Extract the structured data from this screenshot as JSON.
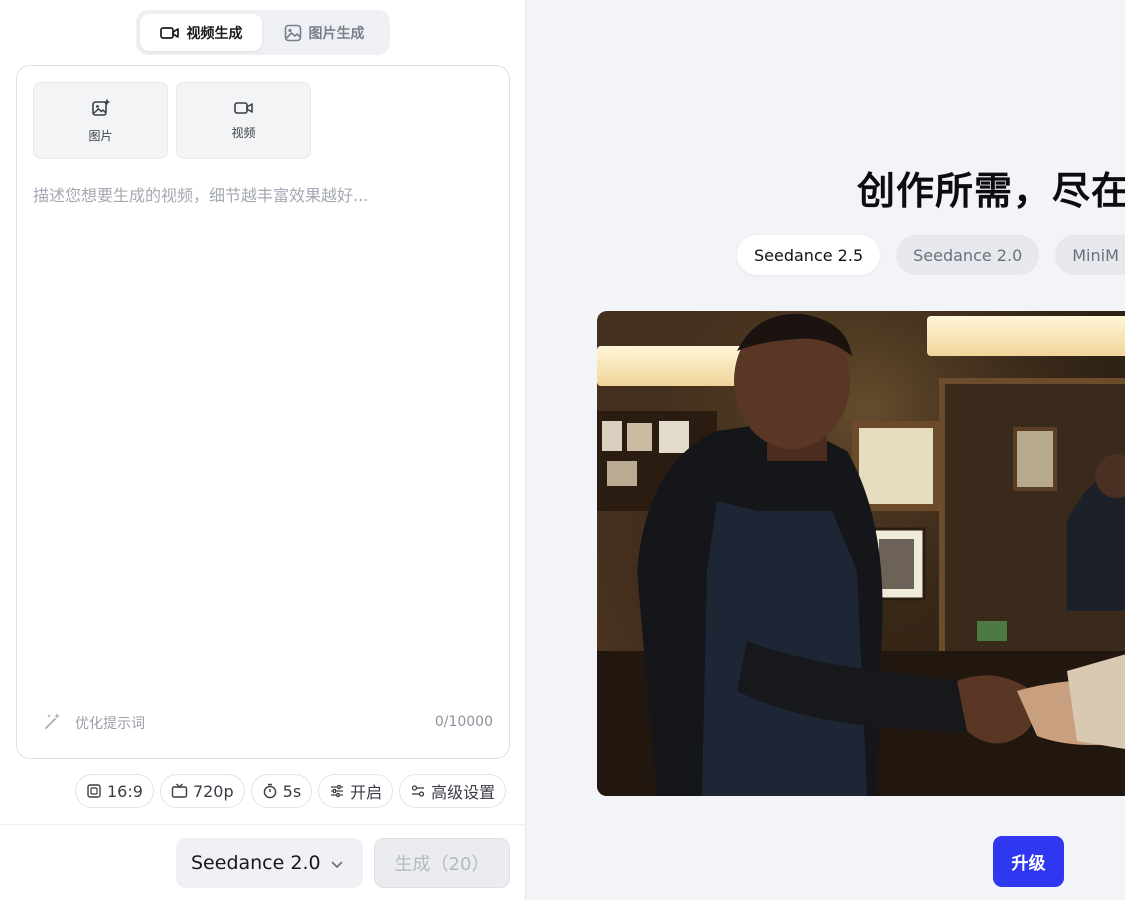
{
  "mode_tabs": {
    "video_label": "视频生成",
    "image_label": "图片生成"
  },
  "editor": {
    "upload_image_label": "图片",
    "upload_video_label": "视频",
    "prompt_placeholder": "描述您想要生成的视频，细节越丰富效果越好...",
    "optimize_label": "优化提示词",
    "char_counter": "0/10000"
  },
  "options": {
    "aspect_ratio": "16:9",
    "resolution": "720p",
    "duration": "5s",
    "toggle": "开启",
    "advanced": "高级设置"
  },
  "bottom_bar": {
    "model": "Seedance 2.0",
    "generate_label": "生成（20）"
  },
  "showcase": {
    "headline": "创作所需，尽在",
    "models": [
      "Seedance 2.5",
      "Seedance 2.0",
      "MiniM"
    ],
    "active_model_index": 0,
    "upgrade_label": "升级"
  },
  "colors": {
    "accent": "#2f37f0",
    "panel_bg": "#ffffff",
    "page_bg": "#f3f4f8"
  },
  "icons": {
    "video": "video-camera-icon",
    "image": "image-icon",
    "image_add": "image-add-icon",
    "magic": "magic-wand-icon",
    "aspect": "aspect-ratio-icon",
    "resolution": "tv-icon",
    "timer": "timer-icon",
    "sliders": "sliders-icon",
    "settings": "advanced-settings-icon",
    "chevron": "chevron-down-icon"
  }
}
